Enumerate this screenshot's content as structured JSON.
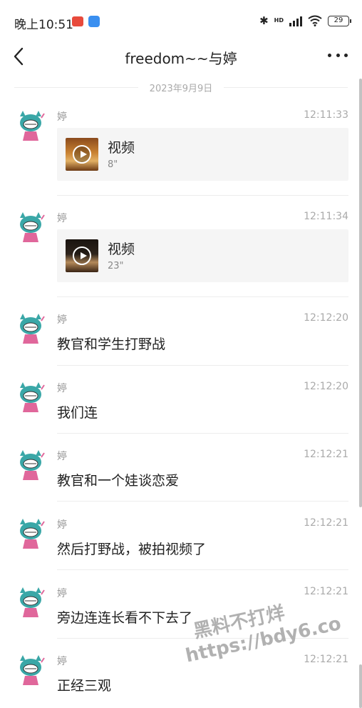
{
  "status_bar": {
    "time": "晚上10:51",
    "battery": "29",
    "signal_label": "HD"
  },
  "header": {
    "title": "freedom~~与婷"
  },
  "date_divider": "2023年9月9日",
  "messages": [
    {
      "sender": "婷",
      "time": "12:11:33",
      "type": "video",
      "video_title": "视频",
      "video_duration": "8\""
    },
    {
      "sender": "婷",
      "time": "12:11:34",
      "type": "video",
      "video_title": "视频",
      "video_duration": "23\""
    },
    {
      "sender": "婷",
      "time": "12:12:20",
      "type": "text",
      "text": "教官和学生打野战"
    },
    {
      "sender": "婷",
      "time": "12:12:20",
      "type": "text",
      "text": "我们连"
    },
    {
      "sender": "婷",
      "time": "12:12:21",
      "type": "text",
      "text": "教官和一个娃谈恋爱"
    },
    {
      "sender": "婷",
      "time": "12:12:21",
      "type": "text",
      "text": "然后打野战，被拍视频了"
    },
    {
      "sender": "婷",
      "time": "12:12:21",
      "type": "text",
      "text": "旁边连连长看不下去了"
    },
    {
      "sender": "婷",
      "time": "12:12:21",
      "type": "text",
      "text": "正经三观"
    }
  ],
  "watermark": {
    "line1": "黑料不打烊",
    "line2": "https://bdy6.co"
  },
  "colors": {
    "accent_red": "#e84a3c",
    "accent_blue": "#3a8ff0",
    "avatar_teal": "#3aa7a7",
    "avatar_pink": "#e0679b"
  }
}
